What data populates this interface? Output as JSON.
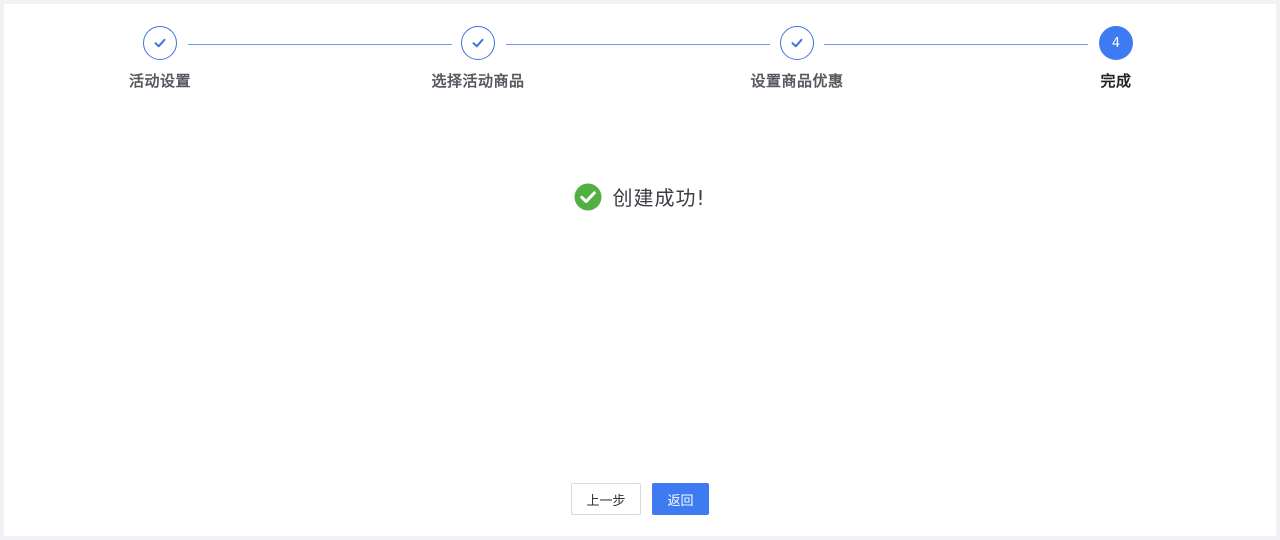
{
  "steps": [
    {
      "label": "活动设置",
      "status": "done",
      "icon": "check-icon"
    },
    {
      "label": "选择活动商品",
      "status": "done",
      "icon": "check-icon"
    },
    {
      "label": "设置商品优惠",
      "status": "done",
      "icon": "check-icon"
    },
    {
      "label": "完成",
      "status": "current",
      "number": "4"
    }
  ],
  "result": {
    "icon": "success-check-circle-icon",
    "message": "创建成功!"
  },
  "actions": {
    "prev_label": "上一步",
    "back_label": "返回"
  },
  "colors": {
    "primary": "#3e7bf2",
    "line": "#6f9ae8",
    "success": "#52b043"
  }
}
